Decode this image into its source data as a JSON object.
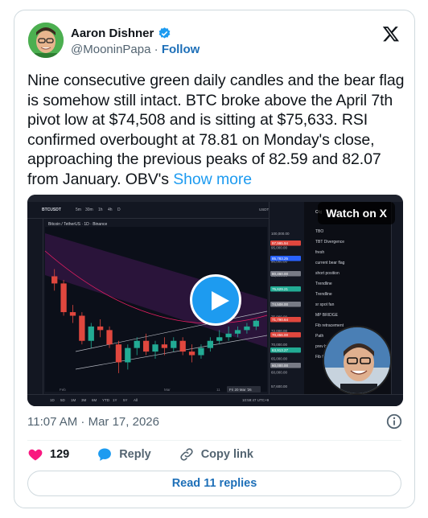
{
  "author": {
    "name": "Aaron Dishner",
    "handle": "@MooninPapa",
    "separator": "·",
    "follow_label": "Follow"
  },
  "tweet": {
    "text": "Nine consecutive green daily candles and the bear flag is somehow still intact. BTC broke above the April 7th pivot low at $74,508 and is sitting at $75,633. RSI confirmed overbought at 78.81 on Monday's close, approaching the previous peaks of 82.59 and 82.07 from January. OBV's",
    "show_more": "Show more"
  },
  "media": {
    "watch_label": "Watch on X",
    "chart": {
      "symbol": "BTCUSDT",
      "title": "Bitcoin / TetherUS · 1D · Binance",
      "intervals": [
        "5m",
        "30m",
        "1h",
        "4h",
        "D"
      ],
      "ranges": [
        "1D",
        "5D",
        "1M",
        "3M",
        "6M",
        "YTD",
        "1Y",
        "5Y",
        "All"
      ],
      "clock": "10:59:47 UTC+9",
      "date_tag": "Fri 20 Mar '26",
      "x_labels": [
        "Feb",
        "Mar",
        "11"
      ],
      "currency": "USDT",
      "price_labels": [
        "100,000.00",
        "95,000.00",
        "90,000.00",
        "85,000.00",
        "82,000.00",
        "78,000.00",
        "75,000.00",
        "72,000.00",
        "70,000.00",
        "65,000.00",
        "60,000.00",
        "57,600.00"
      ],
      "highlight_prices": [
        {
          "text": "97,995.94",
          "color": "#e0473e"
        },
        {
          "text": "85,783.25",
          "color": "#2962ff"
        },
        {
          "text": "80,460.00",
          "color": "#787b86"
        },
        {
          "text": "75,629.21",
          "color": "#22ab94"
        },
        {
          "text": "74,508.00",
          "color": "#787b86"
        },
        {
          "text": "71,790.64",
          "color": "#e0473e"
        },
        {
          "text": "70,456.00",
          "color": "#e0473e"
        },
        {
          "text": "63,913.27",
          "color": "#22ab94"
        },
        {
          "text": "60,000.00",
          "color": "#787b86"
        }
      ],
      "panel_tab": "Obj",
      "panel_items": [
        "TBO",
        "TBT Divergence",
        "fresh",
        "current bear flag",
        "short position",
        "Trendline",
        "Trendline",
        "sr spot fan",
        "MP BRIDGE",
        "Fib retracement",
        "Path",
        "prev bear flag",
        "Fib fan"
      ],
      "candles": [
        {
          "o": 88,
          "c": 86,
          "h": 90,
          "l": 84
        },
        {
          "o": 86,
          "c": 78,
          "h": 87,
          "l": 77
        },
        {
          "o": 78,
          "c": 77,
          "h": 80,
          "l": 75
        },
        {
          "o": 77,
          "c": 70,
          "h": 78,
          "l": 69
        },
        {
          "o": 70,
          "c": 74,
          "h": 75,
          "l": 68
        },
        {
          "o": 74,
          "c": 73,
          "h": 76,
          "l": 71
        },
        {
          "o": 73,
          "c": 69,
          "h": 74,
          "l": 68
        },
        {
          "o": 69,
          "c": 64,
          "h": 70,
          "l": 61
        },
        {
          "o": 64,
          "c": 68,
          "h": 69,
          "l": 62
        },
        {
          "o": 68,
          "c": 70,
          "h": 71,
          "l": 66
        },
        {
          "o": 70,
          "c": 67,
          "h": 72,
          "l": 66
        },
        {
          "o": 67,
          "c": 69,
          "h": 70,
          "l": 65
        },
        {
          "o": 69,
          "c": 68,
          "h": 71,
          "l": 66
        },
        {
          "o": 68,
          "c": 70,
          "h": 71,
          "l": 67
        },
        {
          "o": 70,
          "c": 67,
          "h": 71,
          "l": 66
        },
        {
          "o": 67,
          "c": 66,
          "h": 69,
          "l": 64
        },
        {
          "o": 66,
          "c": 68,
          "h": 69,
          "l": 65
        },
        {
          "o": 68,
          "c": 70,
          "h": 71,
          "l": 67
        },
        {
          "o": 70,
          "c": 71,
          "h": 73,
          "l": 69
        },
        {
          "o": 71,
          "c": 72,
          "h": 74,
          "l": 70
        },
        {
          "o": 72,
          "c": 73,
          "h": 74,
          "l": 71
        },
        {
          "o": 73,
          "c": 74,
          "h": 75,
          "l": 72
        },
        {
          "o": 74,
          "c": 75.6,
          "h": 76,
          "l": 73
        }
      ]
    }
  },
  "meta": {
    "timestamp": "11:07 AM · Mar 17, 2026"
  },
  "actions": {
    "likes": "129",
    "reply_label": "Reply",
    "copy_link_label": "Copy link",
    "read_replies_label": "Read 11 replies"
  },
  "colors": {
    "accent": "#1d9bf0",
    "follow": "#1d6fb8",
    "like": "#f91880",
    "up": "#22ab94",
    "down": "#e0473e"
  }
}
